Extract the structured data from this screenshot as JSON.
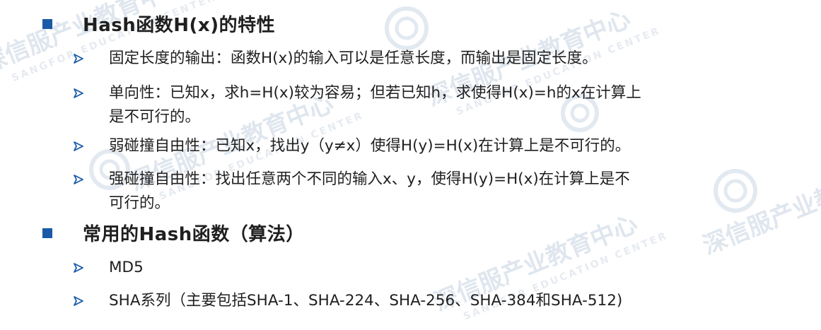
{
  "sections": [
    {
      "heading": "Hash函数H(x)的特性",
      "items": [
        {
          "lines": [
            "固定长度的输出：函数H(x)的输入可以是任意长度，而输出是固定长度。"
          ]
        },
        {
          "lines": [
            "单向性：已知x，求h=H(x)较为容易；但若已知h，求使得H(x)=h的x在计算上",
            "是不可行的。"
          ]
        },
        {
          "lines": [
            "弱碰撞自由性：已知x，找出y（y≠x）使得H(y)=H(x)在计算上是不可行的。"
          ]
        },
        {
          "lines": [
            "强碰撞自由性：找出任意两个不同的输入x、y，使得H(y)=H(x)在计算上是不",
            "可行的。"
          ]
        }
      ]
    },
    {
      "heading": "常用的Hash函数（算法）",
      "items": [
        {
          "lines": [
            "MD5"
          ]
        },
        {
          "lines": [
            "SHA系列（主要包括SHA-1、SHA-224、SHA-256、SHA-384和SHA-512)"
          ]
        }
      ]
    }
  ],
  "watermark": {
    "text": "深信服产业教育中心",
    "subtext": "SANGFOR EDUCATION CENTER"
  },
  "colors": {
    "bullet_square": "#1a5aa8",
    "bullet_arrow": "#1a5aa8",
    "text": "#1f1f1f",
    "watermark": "#dfe6ee"
  }
}
